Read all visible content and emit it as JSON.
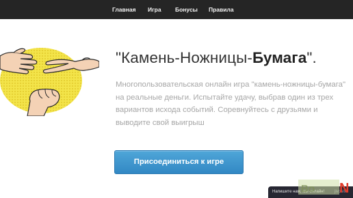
{
  "nav": {
    "items": [
      {
        "label": "Главная"
      },
      {
        "label": "Игра"
      },
      {
        "label": "Бонусы"
      },
      {
        "label": "Правила"
      }
    ]
  },
  "hero": {
    "title_prefix": "\"Камень-Ножницы-",
    "title_bold": "Бумага",
    "title_suffix": "\".",
    "description": "Многопользовательская онлайн игра \"камень-ножницы-бумага\" на реальные деньги. Испытайте удачу, выбрав один из трех вариантов исхода событий. Соревнуйтесь с друзьями и выводите свой выигрыш",
    "join_button": "Присоединиться к игре"
  },
  "chat": {
    "label": "Напишите нам, мы онлайн!",
    "brand": "jivosite"
  },
  "colors": {
    "navbar": "#252525",
    "button": "#3a95cf",
    "description": "#a6a6a6",
    "art_yellow": "#f3e44a"
  }
}
